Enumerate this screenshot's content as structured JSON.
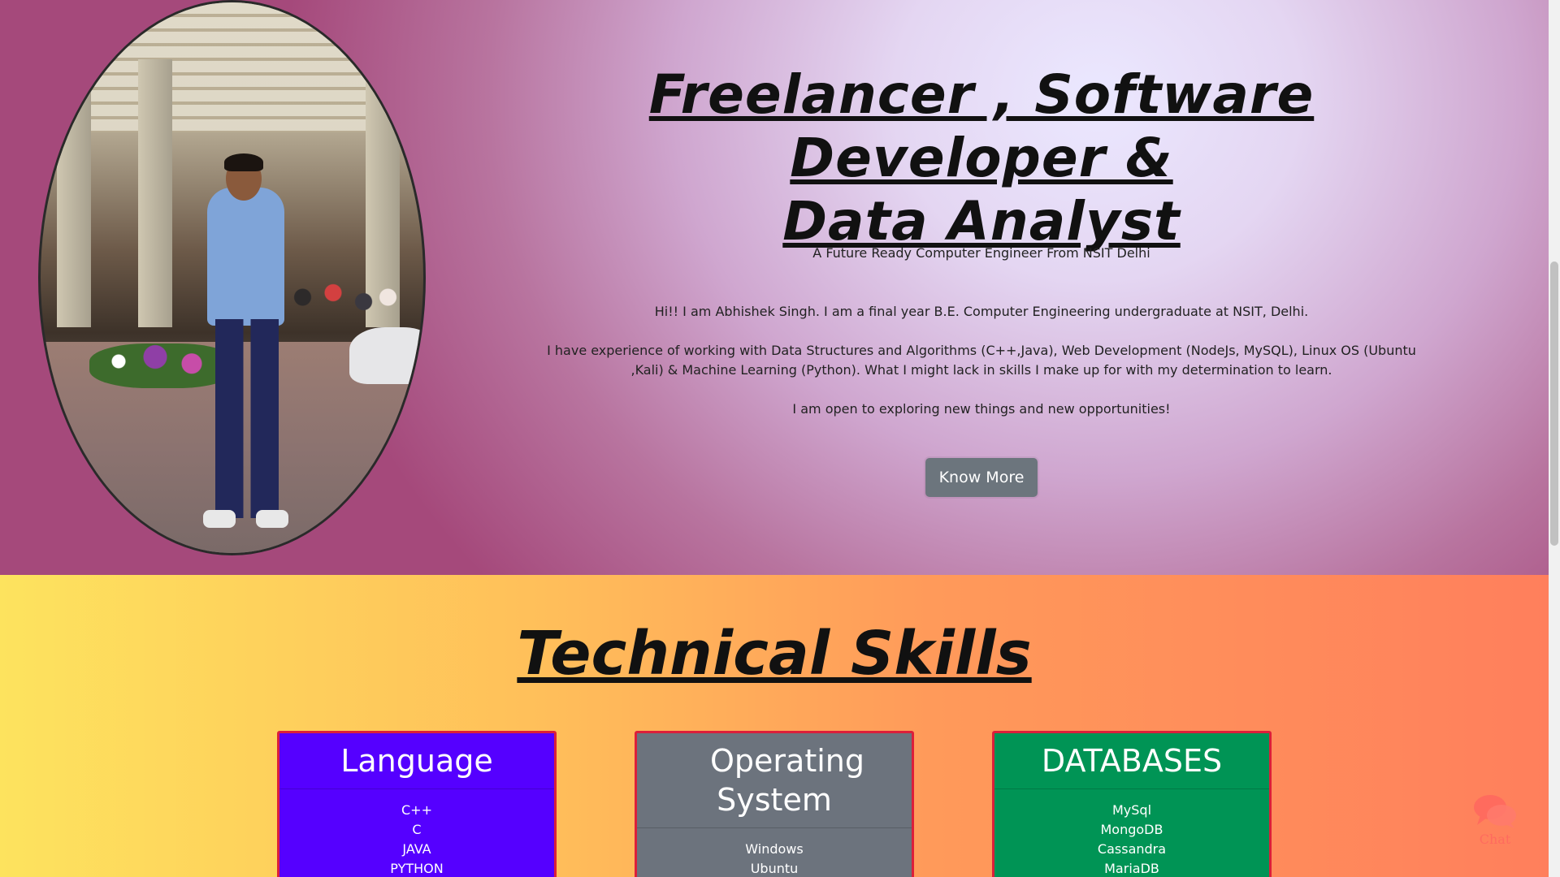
{
  "hero": {
    "headline_line1": "Freelancer , Software Developer &",
    "headline_line2": "Data Analyst",
    "subtitle": "A Future Ready Computer Engineer From NSIT Delhi",
    "intro": "Hi!! I am Abhishek Singh. I am a final year B.E. Computer Engineering undergraduate at NSIT, Delhi.",
    "experience": "I have experience of working with Data Structures and Algorithms (C++,Java), Web Development (NodeJs, MySQL), Linux OS (Ubuntu ,Kali) & Machine Learning (Python). What I might lack in skills I make up for with my determination to learn.",
    "closing": "I am open to exploring new things and new opportunities!",
    "button_label": "Know More"
  },
  "skills": {
    "title": "Technical Skills",
    "cards": [
      {
        "title": "Language",
        "items": [
          "C++",
          "C",
          "JAVA",
          "PYTHON"
        ],
        "color": "#5500ff"
      },
      {
        "title": "Operating System",
        "items": [
          "Windows",
          "Ubuntu"
        ],
        "color": "#6c737d"
      },
      {
        "title": "DATABASES",
        "items": [
          "MySql",
          "MongoDB",
          "Cassandra",
          "MariaDB"
        ],
        "color": "#009455"
      }
    ],
    "card_border_color": "#dc1f3a"
  },
  "chat": {
    "label": "Chat",
    "icon": "chat-bubbles-icon"
  },
  "icons": {
    "profile": "profile-photo"
  }
}
